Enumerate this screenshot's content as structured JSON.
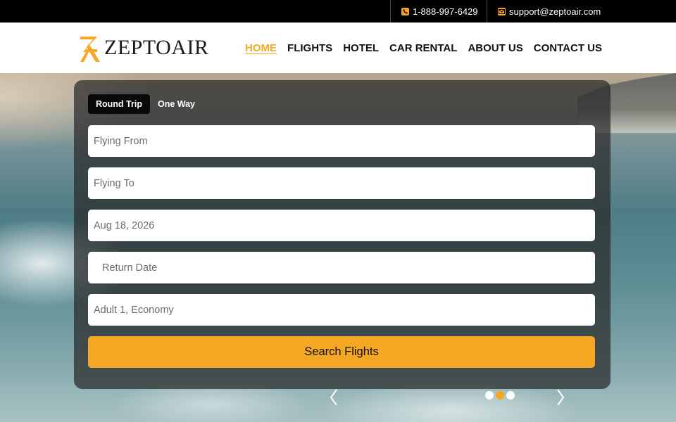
{
  "topbar": {
    "phone": "1-888-997-6429",
    "email": "support@zeptoair.com",
    "phone_icon": "phone-icon",
    "email_icon": "envelope-icon"
  },
  "brand": {
    "name": "ZEPTOAIR",
    "accent": "#f5a623"
  },
  "nav": {
    "items": [
      {
        "label": "HOME",
        "active": true
      },
      {
        "label": "FLIGHTS",
        "active": false
      },
      {
        "label": "HOTEL",
        "active": false
      },
      {
        "label": "CAR RENTAL",
        "active": false
      },
      {
        "label": "ABOUT US",
        "active": false
      },
      {
        "label": "CONTACT US",
        "active": false
      }
    ]
  },
  "search": {
    "tabs": [
      {
        "label": "Round Trip",
        "active": true
      },
      {
        "label": "One Way",
        "active": false
      }
    ],
    "flying_from": "Flying From",
    "flying_to": "Flying To",
    "depart_date": "Aug 18, 2026",
    "return_date": "Return Date",
    "passengers": "Adult 1, Economy",
    "button": "Search Flights"
  },
  "carousel": {
    "slide_count": 3,
    "active_slide": 2,
    "prev_icon": "chevron-left-icon",
    "next_icon": "chevron-right-icon"
  },
  "colors": {
    "topbar_bg": "#000000",
    "accent": "#f5a623",
    "panel_bg": "rgba(40,40,40,0.72)"
  }
}
